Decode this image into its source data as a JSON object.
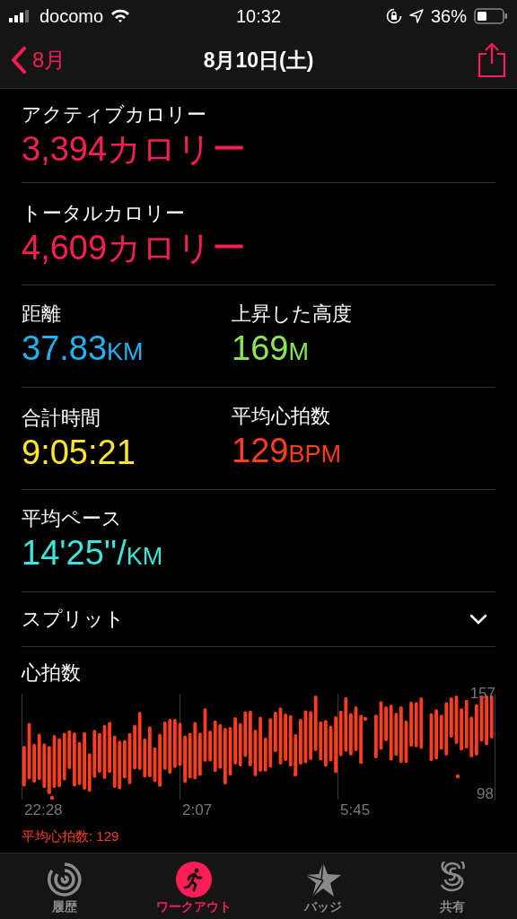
{
  "status_bar": {
    "carrier": "docomo",
    "time": "10:32",
    "battery": "36%"
  },
  "nav": {
    "back": "8月",
    "title": "8月10日(土)"
  },
  "metric_rows": [
    {
      "metrics": [
        {
          "label": "アクティブカロリー",
          "value": "3,394カロリー",
          "color": "#fa1e55"
        }
      ]
    },
    {
      "metrics": [
        {
          "label": "トータルカロリー",
          "value": "4,609カロリー",
          "color": "#fa1e55"
        }
      ]
    },
    {
      "metrics": [
        {
          "label": "距離",
          "value": "37.83",
          "unit": "KM",
          "color": "#1eb4f5"
        },
        {
          "label": "上昇した高度",
          "value": "169",
          "unit": "M",
          "color": "#8ce650"
        }
      ]
    },
    {
      "metrics": [
        {
          "label": "合計時間",
          "value": "9:05:21",
          "color": "#ffe628"
        },
        {
          "label": "平均心拍数",
          "value": "129",
          "unit": "BPM",
          "color": "#ff3c1e"
        }
      ]
    },
    {
      "metrics": [
        {
          "label": "平均ペース",
          "value": "14'25''/",
          "unit": "KM",
          "color": "#3ce6dc"
        }
      ]
    }
  ],
  "splits": {
    "label": "スプリット",
    "expanded": false
  },
  "heart_rate": {
    "title": "心拍数",
    "y_max": "157",
    "y_min": "98",
    "times": [
      "22:28",
      "2:07",
      "5:45"
    ],
    "average": "平均心拍数: 129"
  },
  "tabs": [
    {
      "label": "履歴",
      "selected": false
    },
    {
      "label": "ワークアウト",
      "selected": true
    },
    {
      "label": "バッジ",
      "selected": false
    },
    {
      "label": "共有",
      "selected": false
    }
  ]
}
